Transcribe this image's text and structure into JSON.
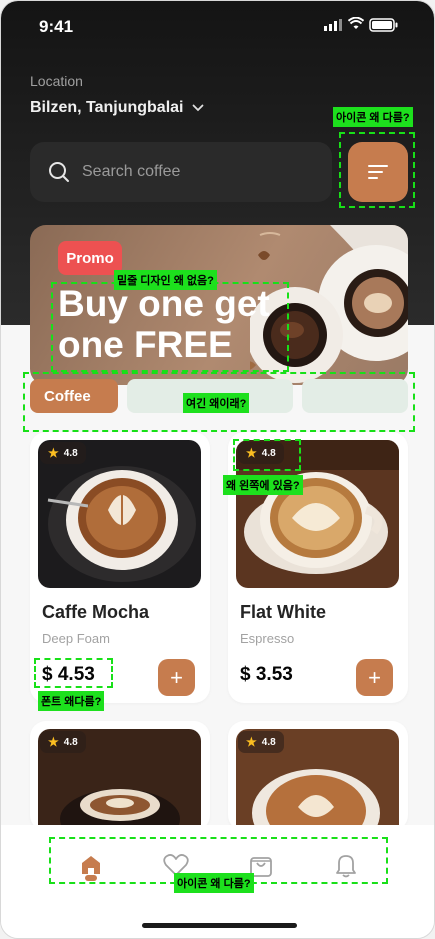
{
  "status_bar": {
    "time": "9:41"
  },
  "location": {
    "label": "Location",
    "value": "Bilzen, Tanjungbalai"
  },
  "search": {
    "placeholder": "Search coffee"
  },
  "promo": {
    "badge": "Promo",
    "headline_line1": "Buy one get",
    "headline_line2": "one FREE"
  },
  "categories": [
    {
      "label": "Coffee"
    },
    {
      "label": ""
    },
    {
      "label": ""
    }
  ],
  "products": [
    {
      "rating": "4.8",
      "name": "Caffe Mocha",
      "subtitle": "Deep Foam",
      "price": "$ 4.53"
    },
    {
      "rating": "4.8",
      "name": "Flat White",
      "subtitle": "Espresso",
      "price": "$ 3.53"
    },
    {
      "rating": "4.8"
    },
    {
      "rating": "4.8"
    }
  ],
  "add_button_label": "+",
  "annotations": [
    "아이콘 왜 다름?",
    "밑줄 디자인 왜 없음?",
    "여긴 왜이래?",
    "왜 왼쪽에 있음?",
    "폰트 왜다름?",
    "아이콘 왜 다름?"
  ],
  "colors": {
    "accent": "#c67c4e",
    "promo_badge": "#ed5151",
    "annotation": "#1de01d",
    "dark_header": "#141414"
  }
}
